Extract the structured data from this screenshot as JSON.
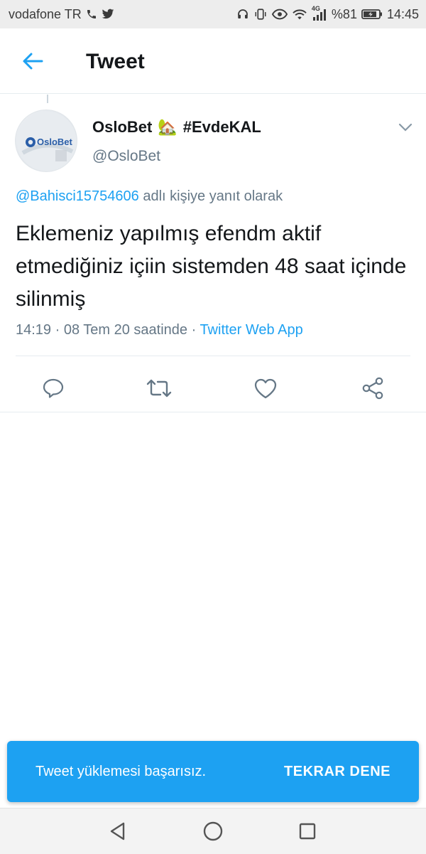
{
  "status_bar": {
    "carrier": "vodafone TR",
    "network": "4G",
    "battery": "%81",
    "time": "14:45",
    "icons": [
      "phone-icon",
      "twitter-icon",
      "headphones-icon",
      "vibrate-icon",
      "eye-icon",
      "wifi-icon",
      "signal-icon",
      "battery-icon"
    ]
  },
  "header": {
    "title": "Tweet",
    "back_icon": "arrow-left-icon"
  },
  "tweet": {
    "display_name": "OsloBet",
    "emoji": "🏡",
    "hashtag": "#EvdeKAL",
    "handle": "@OsloBet",
    "avatar_text": "OsloBet",
    "reply_to_mention": "@Bahisci15754606",
    "reply_to_suffix": " adlı kişiye yanıt olarak",
    "text": "Eklemeniz yapılmış efendm aktif etmediğiniz içiin sistemden 48 saat içinde silinmiş",
    "timestamp": "14:19 · 08 Tem 20 saatinde · ",
    "source": "Twitter Web App"
  },
  "actions": [
    "reply-icon",
    "retweet-icon",
    "like-icon",
    "share-icon"
  ],
  "snackbar": {
    "message": "Tweet yüklemesi başarısız.",
    "action": "TEKRAR DENE"
  },
  "nav": [
    "back-triangle-icon",
    "home-circle-icon",
    "recents-square-icon"
  ],
  "colors": {
    "accent": "#1da1f2",
    "text": "#14171a",
    "muted": "#657786"
  }
}
